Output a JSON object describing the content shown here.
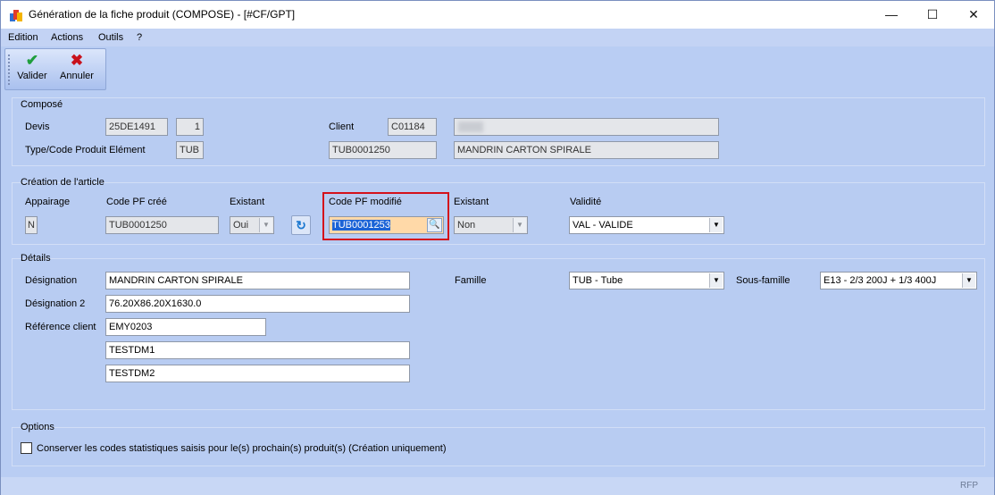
{
  "window": {
    "title": "Génération de la fiche produit (COMPOSE)  -  [#CF/GPT]",
    "minimize_glyph": "—",
    "maximize_glyph": "☐",
    "close_glyph": "✕"
  },
  "menu": [
    "Edition",
    "Actions",
    "Outils",
    "?"
  ],
  "toolbar": {
    "validate_label": "Valider",
    "validate_icon": "check-icon",
    "cancel_label": "Annuler",
    "cancel_icon": "x-icon"
  },
  "compose": {
    "title": "Composé",
    "devis_label": "Devis",
    "devis_value": "25DE1491",
    "devis_index": "1",
    "client_label": "Client",
    "client_code": "C01184",
    "client_name": "",
    "type_label": "Type/Code Produit Elément",
    "type_value": "TUB",
    "code_value": "TUB0001250",
    "designation_value": "MANDRIN CARTON SPIRALE"
  },
  "creation": {
    "title": "Création de l'article",
    "appairage_label": "Appairage",
    "appairage_value": "N",
    "code_cree_label": "Code PF créé",
    "code_cree_value": "TUB0001250",
    "existant1_label": "Existant",
    "existant1_value": "Oui",
    "code_modifie_label": "Code PF modifié",
    "code_modifie_value": "TUB0001253",
    "existant2_label": "Existant",
    "existant2_value": "Non",
    "validite_label": "Validité",
    "validite_value": "VAL - VALIDE"
  },
  "details": {
    "title": "Détails",
    "designation_label": "Désignation",
    "designation_value": "MANDRIN CARTON SPIRALE",
    "designation2_label": "Désignation 2",
    "designation2_value": "76.20X86.20X1630.0",
    "ref_client_label": "Référence client",
    "ref_client_value": "EMY0203",
    "extra1_value": "TESTDM1",
    "extra2_value": "TESTDM2",
    "famille_label": "Famille",
    "famille_value": "TUB - Tube",
    "sous_famille_label": "Sous-famille",
    "sous_famille_value": "E13 - 2/3 200J + 1/3 400J"
  },
  "options": {
    "title": "Options",
    "checkbox_label": "Conserver les codes statistiques saisis pour le(s) prochain(s) produit(s) (Création uniquement)",
    "checked": false
  },
  "status": {
    "rfp": "RFP"
  },
  "colors": {
    "accent_check": "#1f9e3c",
    "accent_cancel": "#c8121c",
    "highlight_border": "#d4111b",
    "selection": "#1b63d6"
  }
}
